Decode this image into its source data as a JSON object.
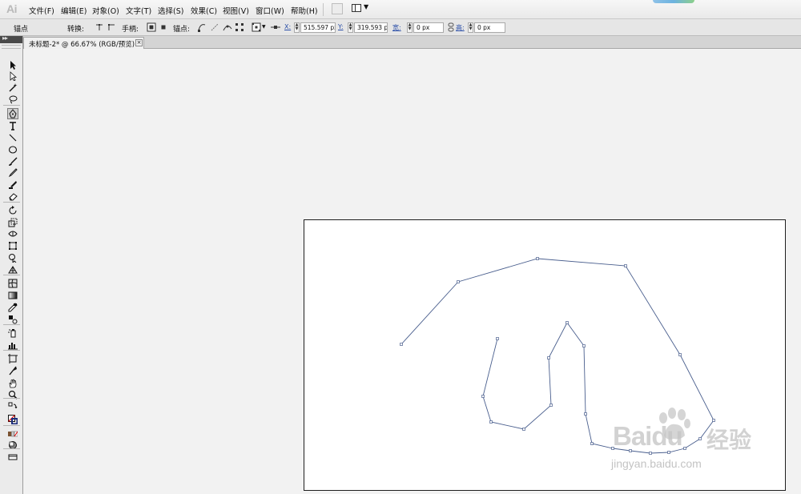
{
  "app": {
    "logo": "Ai"
  },
  "menu": [
    "文件(F)",
    "编辑(E)",
    "对象(O)",
    "文字(T)",
    "选择(S)",
    "效果(C)",
    "视图(V)",
    "窗口(W)",
    "帮助(H)"
  ],
  "control": {
    "mode_label": "锚点",
    "convert_label": "转换:",
    "handles_label": "手柄:",
    "anchors_label": "锚点:",
    "x_label": "X:",
    "x_value": "515.597 px",
    "y_label": "Y:",
    "y_value": "319.593 px",
    "w_label": "宽:",
    "w_value": "0 px",
    "h_label": "高:",
    "h_value": "0 px"
  },
  "document": {
    "tab_title": "未标题-2* @ 66.67% (RGB/预览)",
    "close_glyph": "×"
  },
  "tools": [
    "selection-tool-icon",
    "direct-selection-tool-icon",
    "magic-wand-tool-icon",
    "lasso-tool-icon",
    "pen-tool-icon",
    "type-tool-icon",
    "line-segment-tool-icon",
    "ellipse-tool-icon",
    "paintbrush-tool-icon",
    "pencil-tool-icon",
    "blob-brush-tool-icon",
    "eraser-tool-icon",
    "rotate-tool-icon",
    "scale-tool-icon",
    "width-tool-icon",
    "free-transform-tool-icon",
    "shape-builder-tool-icon",
    "perspective-grid-tool-icon",
    "mesh-tool-icon",
    "gradient-tool-icon",
    "eyedropper-tool-icon",
    "blend-tool-icon",
    "symbol-sprayer-tool-icon",
    "column-graph-tool-icon",
    "artboard-tool-icon",
    "slice-tool-icon",
    "hand-tool-icon",
    "zoom-tool-icon",
    "swap-colors-icon",
    "fill-stroke-icon",
    "color-mode-icon",
    "draw-mode-icon",
    "screen-mode-icon"
  ],
  "active_tool": "pen-tool-icon",
  "colors": {
    "path_stroke": "#4a5f8e",
    "artboard_border": "#1f1f1f",
    "toolbar_header": "#4a4a4a"
  },
  "watermark": {
    "logo_text": "Baidu",
    "suffix": "经验",
    "url": "jingyan.baidu.com"
  }
}
